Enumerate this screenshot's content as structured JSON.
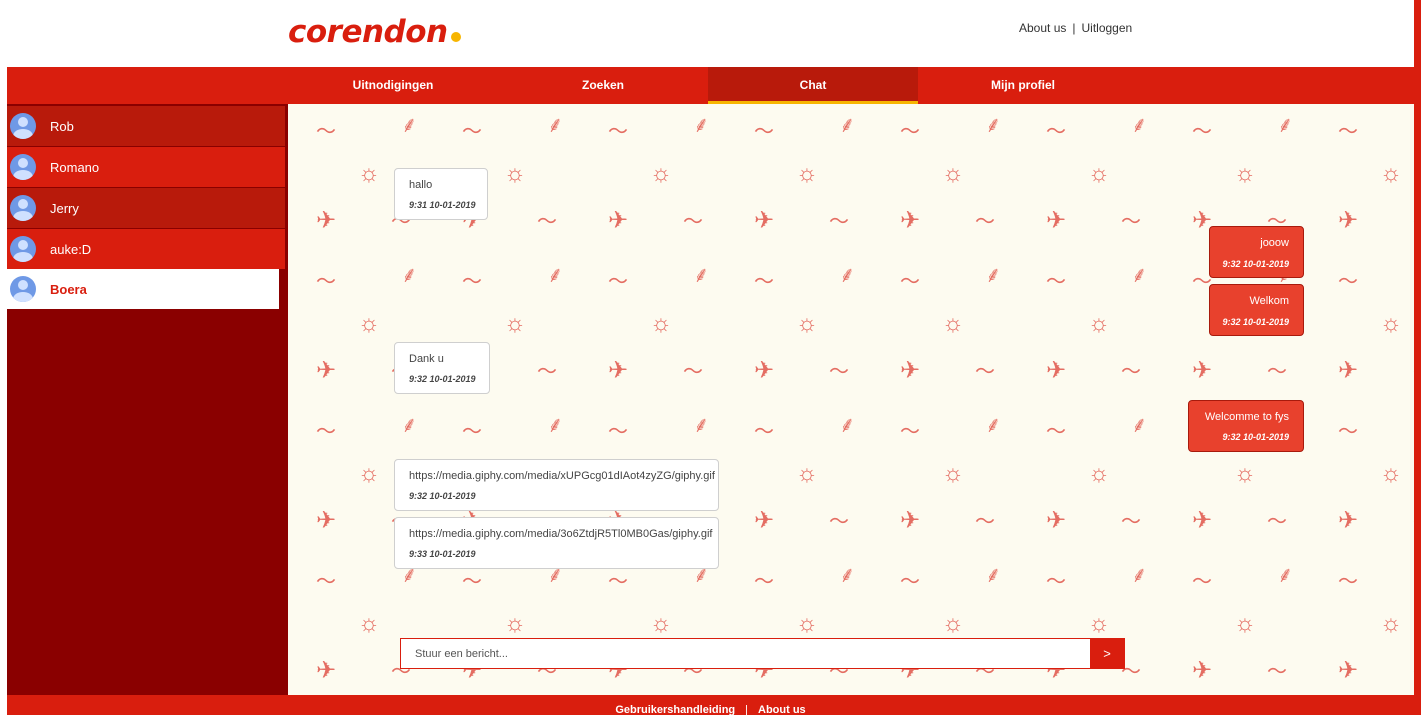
{
  "brand": {
    "name": "corendon",
    "accent": "#d91e0e",
    "dot_color": "#f7b500"
  },
  "toplinks": {
    "about": "About us",
    "separator": "|",
    "logout": "Uitloggen"
  },
  "nav": [
    {
      "label": "Uitnodigingen",
      "active": false
    },
    {
      "label": "Zoeken",
      "active": false
    },
    {
      "label": "Chat",
      "active": true
    },
    {
      "label": "Mijn profiel",
      "active": false
    }
  ],
  "contacts": [
    {
      "name": "Rob",
      "icon": "user-avatar-icon"
    },
    {
      "name": "Romano",
      "icon": "user-avatar-icon"
    },
    {
      "name": "Jerry",
      "icon": "user-avatar-icon"
    },
    {
      "name": "auke:D",
      "icon": "user-avatar-icon"
    },
    {
      "name": "Boera",
      "icon": "user-avatar-icon",
      "selected": true
    }
  ],
  "messages": [
    {
      "direction": "in",
      "text": "hallo",
      "time": "9:31  10-01-2019"
    },
    {
      "direction": "out",
      "text": "jooow",
      "time": "9:32  10-01-2019"
    },
    {
      "direction": "out",
      "text": "Welkom",
      "time": "9:32  10-01-2019"
    },
    {
      "direction": "in",
      "text": "Dank u",
      "time": "9:32  10-01-2019"
    },
    {
      "direction": "out",
      "text": "Welcomme to fys",
      "time": "9:32  10-01-2019"
    },
    {
      "direction": "in",
      "text": "https://media.giphy.com/media/xUPGcg01dIAot4zyZG/giphy.gif",
      "time": "9:32  10-01-2019"
    },
    {
      "direction": "in",
      "text": "https://media.giphy.com/media/3o6ZtdjR5Tl0MB0Gas/giphy.gif",
      "time": "9:33  10-01-2019"
    }
  ],
  "composer": {
    "placeholder": "Stuur een bericht...",
    "send_label": ">"
  },
  "footer": {
    "manual": "Gebruikershandleiding",
    "separator": "|",
    "about": "About us"
  },
  "pattern_icons": [
    "wave-icon",
    "palm-tree-icon",
    "sun-icon",
    "airplane-icon"
  ]
}
